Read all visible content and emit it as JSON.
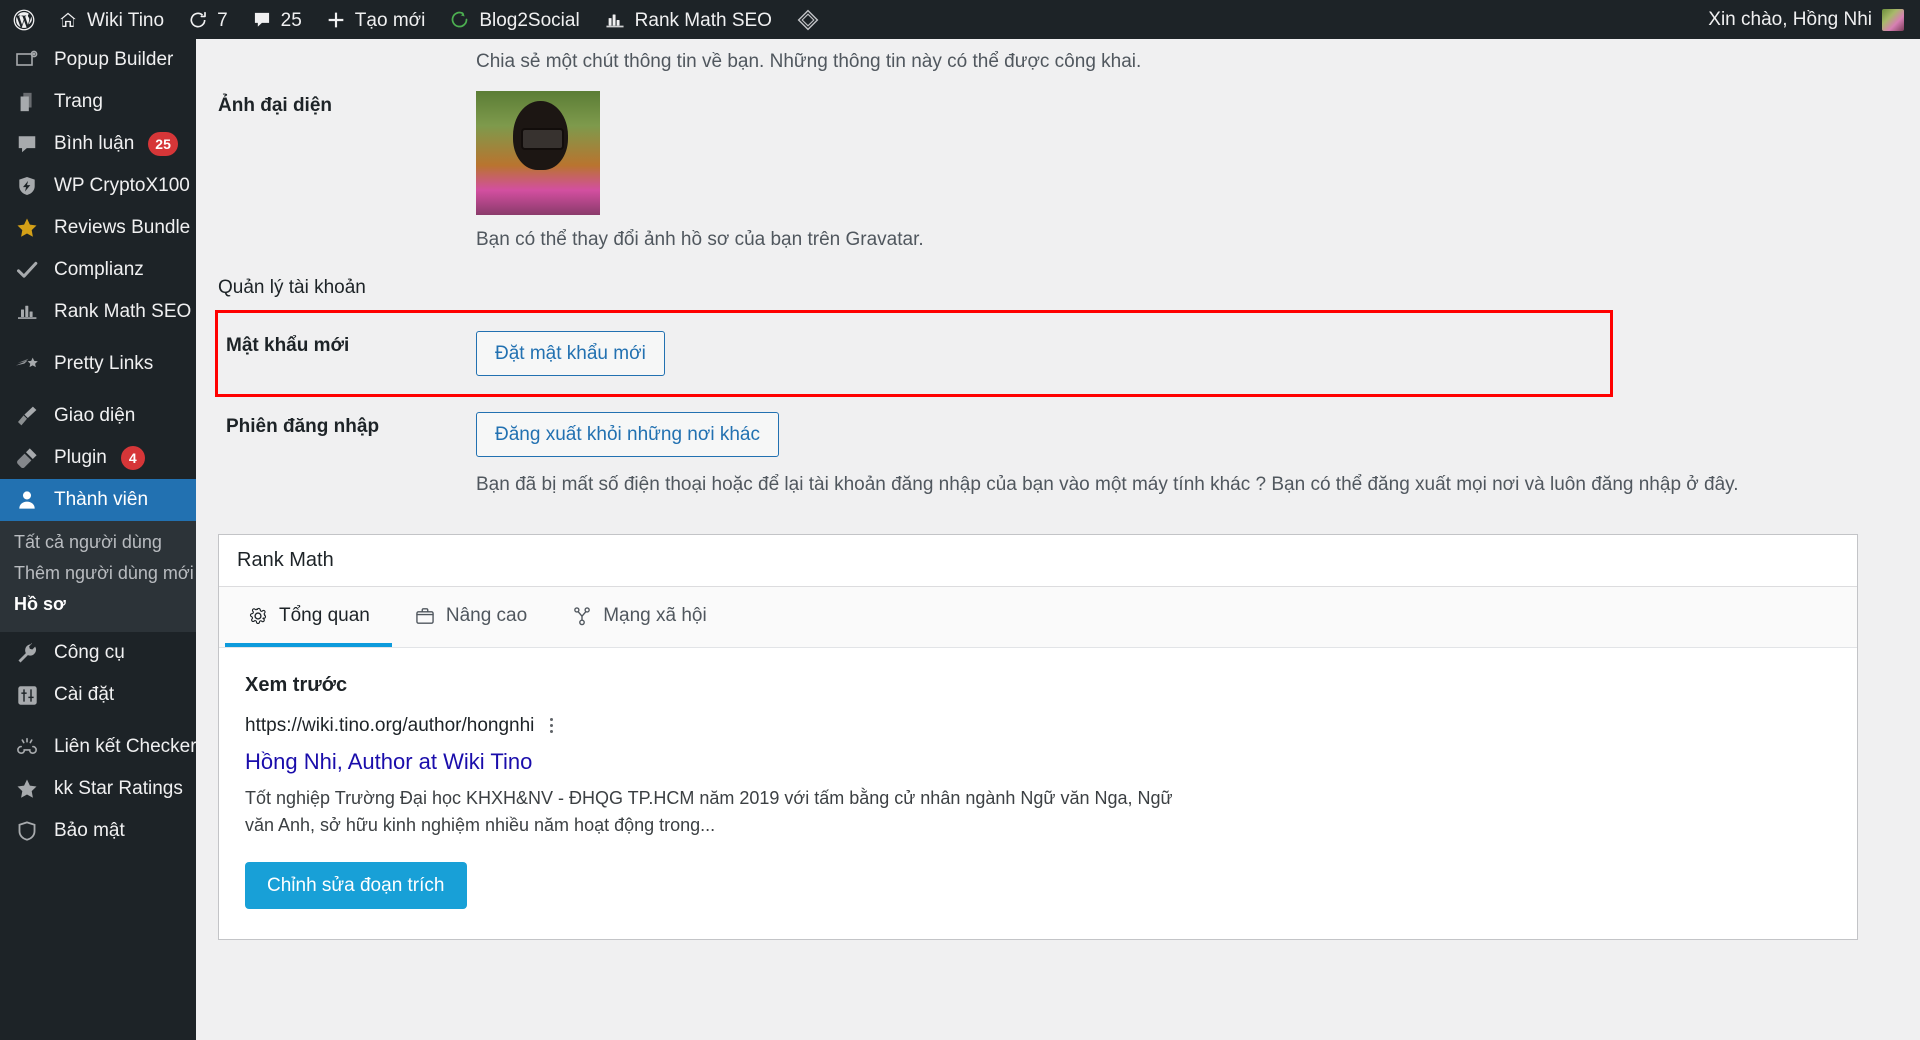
{
  "adminbar": {
    "left_items": [
      {
        "icon": "wordpress-logo-icon",
        "label": ""
      },
      {
        "icon": "home-icon",
        "label": "Wiki Tino"
      },
      {
        "icon": "update-icon",
        "label": "7"
      },
      {
        "icon": "comment-bubble-icon",
        "label": "25"
      },
      {
        "icon": "plus-icon",
        "label": "Tạo mới"
      },
      {
        "icon": "blog2social-icon",
        "label": "Blog2Social"
      },
      {
        "icon": "rank-math-icon",
        "label": "Rank Math SEO"
      },
      {
        "icon": "jetpack-diamond-icon",
        "label": ""
      }
    ],
    "greeting": "Xin chào, Hồng Nhi"
  },
  "sidebar": {
    "items": [
      {
        "label": "Popup Builder",
        "icon": "popup-builder-icon",
        "badge": null,
        "current": false
      },
      {
        "label": "Trang",
        "icon": "pages-icon",
        "badge": null,
        "current": false
      },
      {
        "label": "Bình luận",
        "icon": "comments-icon",
        "badge": "25",
        "current": false
      },
      {
        "label": "WP CryptoX100",
        "icon": "shield-bolt-icon",
        "badge": null,
        "current": false
      },
      {
        "label": "Reviews Bundle",
        "icon": "star-filled-icon",
        "badge": null,
        "current": false
      },
      {
        "label": "Complianz",
        "icon": "check-icon",
        "badge": null,
        "current": false
      },
      {
        "label": "Rank Math SEO",
        "icon": "rank-math-icon",
        "badge": null,
        "current": false
      },
      {
        "label": "Pretty Links",
        "icon": "pretty-links-icon",
        "badge": null,
        "current": false
      },
      {
        "label": "Giao diện",
        "icon": "appearance-brush-icon",
        "badge": null,
        "current": false
      },
      {
        "label": "Plugin",
        "icon": "plugin-plug-icon",
        "badge": "4",
        "current": false
      },
      {
        "label": "Thành viên",
        "icon": "users-icon",
        "badge": null,
        "current": true
      }
    ],
    "submenu": [
      {
        "label": "Tất cả người dùng",
        "current": false
      },
      {
        "label": "Thêm người dùng mới",
        "current": false
      },
      {
        "label": "Hồ sơ",
        "current": true
      }
    ],
    "items_after": [
      {
        "label": "Công cụ",
        "icon": "tools-wrench-icon",
        "badge": null,
        "current": false
      },
      {
        "label": "Cài đặt",
        "icon": "settings-sliders-icon",
        "badge": null,
        "current": false
      },
      {
        "label": "Liên kết Checker",
        "icon": "link-checker-icon",
        "badge": null,
        "current": false
      },
      {
        "label": "kk Star Ratings",
        "icon": "star-filled-icon",
        "badge": null,
        "current": false
      },
      {
        "label": "Bảo mật",
        "icon": "security-shield-icon",
        "badge": null,
        "current": false
      }
    ]
  },
  "profile": {
    "top_description": "Chia sẻ một chút thông tin về bạn. Những thông tin này có thể được công khai.",
    "avatar_label": "Ảnh đại diện",
    "avatar_note": "Bạn có thể thay đổi ảnh hồ sơ của bạn trên Gravatar.",
    "account_management_label": "Quản lý tài khoản",
    "new_password_label": "Mật khẩu mới",
    "set_new_password_button": "Đặt mật khẩu mới",
    "sessions_label": "Phiên đăng nhập",
    "logout_everywhere_button": "Đăng xuất khỏi những nơi khác",
    "sessions_help": "Bạn đã bị mất số điện thoại hoặc để lại tài khoản đăng nhập của bạn vào một máy tính khác ? Bạn có thể đăng xuất mọi nơi và luôn đăng nhập ở đây."
  },
  "rankmath": {
    "panel_title": "Rank Math",
    "tabs": [
      {
        "label": "Tổng quan",
        "icon": "gear-icon",
        "active": true
      },
      {
        "label": "Nâng cao",
        "icon": "briefcase-icon",
        "active": false
      },
      {
        "label": "Mạng xã hội",
        "icon": "share-nodes-icon",
        "active": false
      }
    ],
    "preview_heading": "Xem trước",
    "snippet_url": "https://wiki.tino.org/author/hongnhi",
    "snippet_title": "Hồng Nhi, Author at Wiki Tino",
    "snippet_description": "Tốt nghiệp Trường Đại học KHXH&NV - ĐHQG TP.HCM năm 2019 với tấm bằng cử nhân ngành Ngữ văn Nga, Ngữ văn Anh, sở hữu kinh nghiệm nhiều năm hoạt động trong...",
    "edit_snippet_button": "Chỉnh sửa đoạn trích"
  },
  "colors": {
    "admin_bar_bg": "#1d2327",
    "sidebar_bg": "#1d2327",
    "current_menu_bg": "#2271b1",
    "badge_red": "#d63638",
    "highlight_red": "#ff0000",
    "link_blue": "#2271b1",
    "rankmath_blue": "#18a0d7",
    "serp_title_blue": "#1a0dab"
  }
}
